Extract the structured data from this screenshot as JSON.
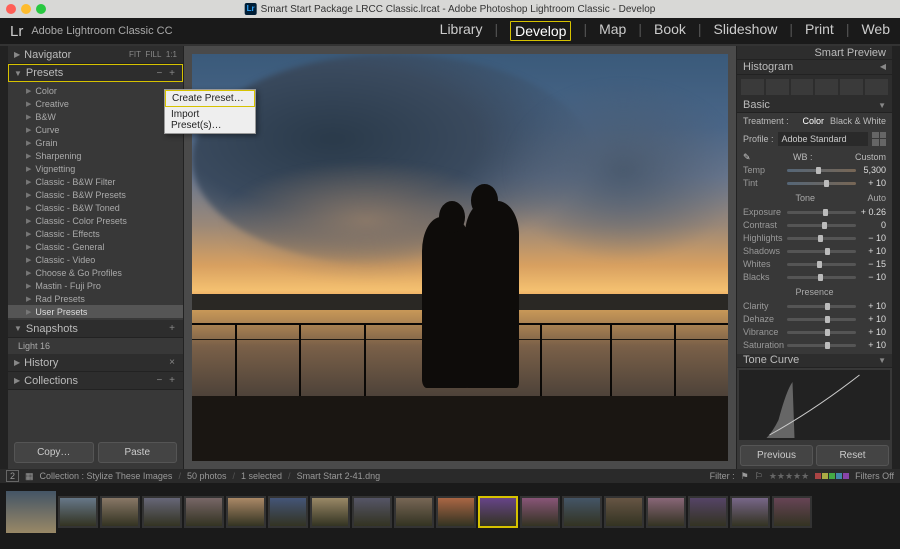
{
  "titlebar": {
    "doc": "Smart Start Package LRCC Classic.lrcat",
    "app": "Adobe Photoshop Lightroom Classic",
    "mode": "Develop"
  },
  "appbar": {
    "logo": "Lr",
    "name": "Adobe Lightroom Classic CC"
  },
  "modules": {
    "library": "Library",
    "develop": "Develop",
    "map": "Map",
    "book": "Book",
    "slideshow": "Slideshow",
    "print": "Print",
    "web": "Web"
  },
  "left": {
    "navigator": "Navigator",
    "fit": "FIT",
    "fill": "FILL",
    "one": "1:1",
    "presets": "Presets",
    "minus": "−",
    "plus": "+",
    "items": [
      "Color",
      "Creative",
      "B&W",
      "Curve",
      "Grain",
      "Sharpening",
      "Vignetting",
      "Classic - B&W Filter",
      "Classic - B&W Presets",
      "Classic - B&W Toned",
      "Classic - Color Presets",
      "Classic - Effects",
      "Classic - General",
      "Classic - Video",
      "Choose & Go Profiles",
      "Mastin - Fuji Pro",
      "Rad Presets",
      "User Presets"
    ],
    "snapshots": "Snapshots",
    "snap1": "Light 16",
    "history": "History",
    "collections": "Collections",
    "copy": "Copy…",
    "paste": "Paste"
  },
  "context": {
    "create": "Create Preset…",
    "import": "Import Preset(s)…"
  },
  "right": {
    "smart": "Smart Preview",
    "histogram": "Histogram",
    "basic": "Basic",
    "treatment": "Treatment :",
    "color": "Color",
    "bw": "Black & White",
    "profile": "Profile :",
    "profile_val": "Adobe Standard",
    "wb": "WB :",
    "wb_val": "Custom",
    "temp": "Temp",
    "temp_v": "5,300",
    "tint": "Tint",
    "tint_v": "+ 10",
    "tone": "Tone",
    "auto": "Auto",
    "exposure": "Exposure",
    "exposure_v": "+ 0.26",
    "contrast": "Contrast",
    "contrast_v": "0",
    "highlights": "Highlights",
    "highlights_v": "− 10",
    "shadows": "Shadows",
    "shadows_v": "+ 10",
    "whites": "Whites",
    "whites_v": "− 15",
    "blacks": "Blacks",
    "blacks_v": "− 10",
    "presence": "Presence",
    "clarity": "Clarity",
    "clarity_v": "+ 10",
    "dehaze": "Dehaze",
    "dehaze_v": "+ 10",
    "vibrance": "Vibrance",
    "vibrance_v": "+ 10",
    "saturation": "Saturation",
    "saturation_v": "+ 10",
    "tonecurve": "Tone Curve",
    "previous": "Previous",
    "reset": "Reset"
  },
  "filmstrip": {
    "collection": "Collection : Stylize These Images",
    "count": "50 photos",
    "sel": "1 selected",
    "file": "Smart Start 2-41.dng",
    "filter": "Filter :",
    "filters_off": "Filters Off"
  }
}
